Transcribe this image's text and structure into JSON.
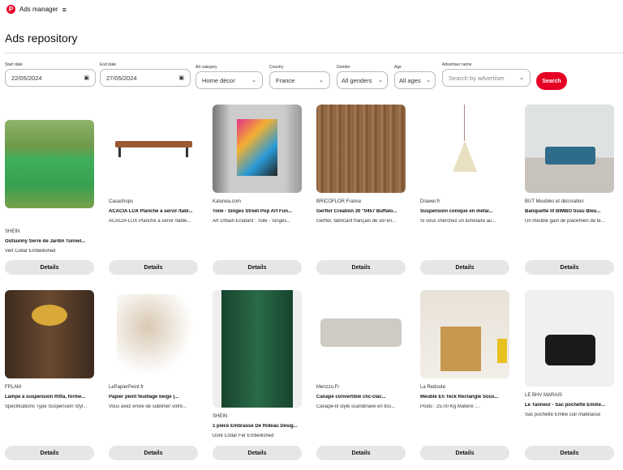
{
  "header": {
    "app_title": "Ads manager",
    "menu_icon": "hamburger-icon"
  },
  "page_title": "Ads repository",
  "filters": {
    "start_date": {
      "label": "Start date",
      "value": "22/05/2024"
    },
    "end_date": {
      "label": "End date",
      "value": "27/05/2024"
    },
    "ad_category": {
      "label": "Ad category",
      "value": "Home décor"
    },
    "country": {
      "label": "Country",
      "value": "France"
    },
    "gender": {
      "label": "Gender",
      "value": "All genders"
    },
    "age": {
      "label": "Age",
      "value": "All ages"
    },
    "advertiser": {
      "label": "Advertiser name",
      "placeholder": "Search by advertiser"
    },
    "search_label": "Search"
  },
  "details_label": "Details",
  "ads": [
    {
      "advertiser": "SHEIN",
      "title": "Outsunny Serre de Jardin Tunnel...",
      "desc": "Vert Collar Embellished"
    },
    {
      "advertiser": "Casashops",
      "title": "ACACIA LUX Planche à servir /tabl...",
      "desc": "ACACIA LUX Planche à servir /table..."
    },
    {
      "advertiser": "Kalunea.com",
      "title": "Toile - Singes Street Pop Art Fun...",
      "desc": "Art Urbain Éclatant : Toile - Singes..."
    },
    {
      "advertiser": "BRICOFLOR France",
      "title": "Gerflor Creation 30 \"0457 Buffalo...",
      "desc": "Gerflor, fabricant français de sol en..."
    },
    {
      "advertiser": "Drawer.fr",
      "title": "Suspension conique en métal...",
      "desc": "Si vous cherchez un luminaire au..."
    },
    {
      "advertiser": "BUT Meubles et décoration",
      "title": "Banquette lit BIMBO tissu Bleu...",
      "desc": "Un meuble gain de placeRien de te..."
    },
    {
      "advertiser": "FPLAM",
      "title": "Lampe à suspension Ritta, forme...",
      "desc": "Spécifications Type Suspension Styl..."
    },
    {
      "advertiser": "LePapierPeint.fr",
      "title": "Papier peint feuillage beige |...",
      "desc": "Vous avez envie de sublimer votre..."
    },
    {
      "advertiser": "SHEIN",
      "title": "1 pièce Embrasse De Rideau Desig...",
      "desc": "Doré Collar Fer Embellished"
    },
    {
      "advertiser": "Menzzo.Fr",
      "title": "Canapé convertible clic-clac...",
      "desc": "Canapé-lit style scandinave en tiss..."
    },
    {
      "advertiser": "La Redoute",
      "title": "Meuble En Teck Rectangle Sous...",
      "desc": "Poids : 25.00 Kg Matière :..."
    },
    {
      "advertiser": "LE BHV MARAIS",
      "title": "Le Tanneur - Sac pochette Emilie...",
      "desc": "Sac pochette Emilie cuir matelassé"
    }
  ],
  "colors": {
    "accent": "#e60023",
    "button_bg": "#e6e6e6"
  }
}
